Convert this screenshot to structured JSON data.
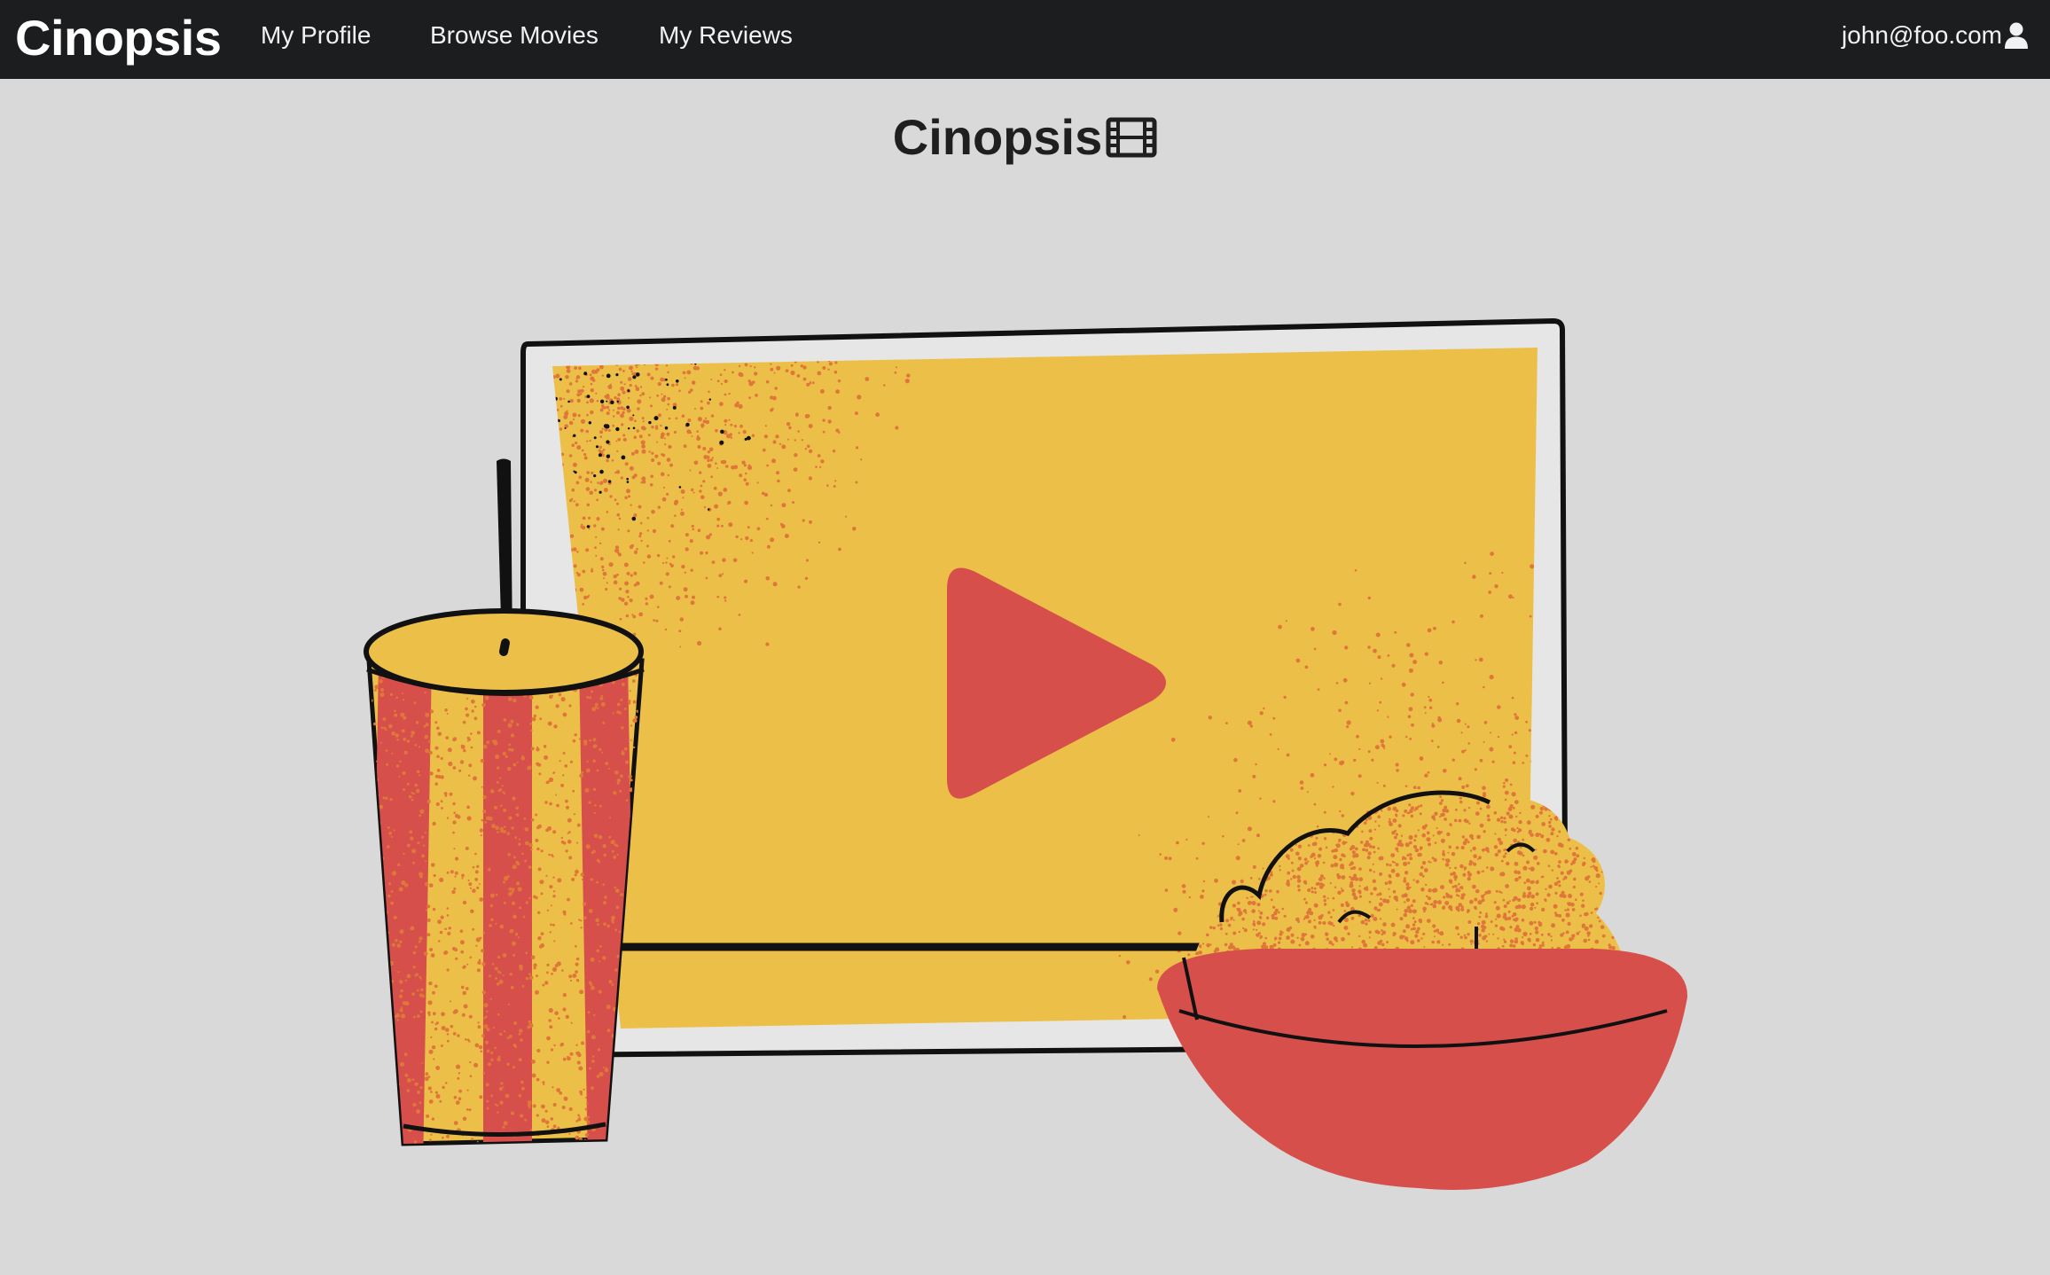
{
  "navbar": {
    "brand": "Cinopsis",
    "links": [
      {
        "label": "My Profile"
      },
      {
        "label": "Browse Movies"
      },
      {
        "label": "My Reviews"
      }
    ],
    "user_email": "john@foo.com",
    "user_icon": "user-icon"
  },
  "main": {
    "title": "Cinopsis",
    "title_icon": "film-icon",
    "hero_illustration": "movie-screen-with-play-button-soda-cup-popcorn-bowl"
  },
  "colors": {
    "navbar_bg": "#1c1d1f",
    "page_bg": "#d9d9d9",
    "screen_yellow": "#ecc048",
    "accent_red": "#d64f4b",
    "speckle_orange": "#e0773a",
    "outline_black": "#111111"
  }
}
